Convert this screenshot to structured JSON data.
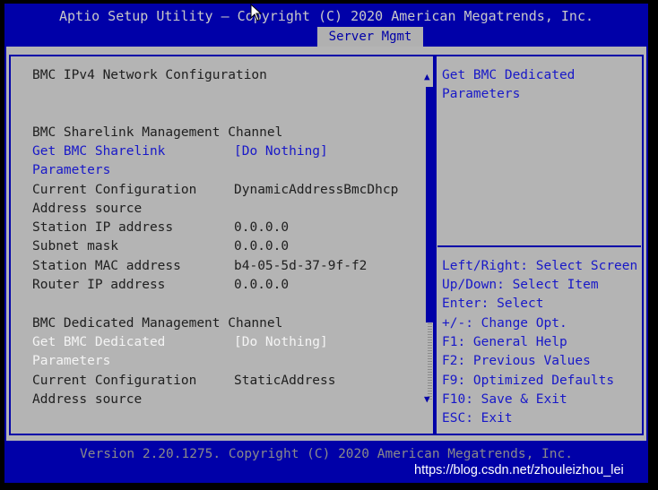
{
  "header": {
    "title": "Aptio Setup Utility – Copyright (C) 2020 American Megatrends, Inc.",
    "active_tab": "Server Mgmt"
  },
  "main": {
    "section_title": "BMC IPv4 Network Configuration",
    "sharelink": {
      "heading": "BMC Sharelink Management Channel",
      "option_label_1": "Get BMC Sharelink",
      "option_label_2": "Parameters",
      "option_value": "[Do Nothing]",
      "rows": [
        {
          "label": "Current Configuration",
          "value": "DynamicAddressBmcDhcp"
        },
        {
          "label": "Address source",
          "value": ""
        },
        {
          "label": "Station IP address",
          "value": "0.0.0.0"
        },
        {
          "label": "Subnet mask",
          "value": "0.0.0.0"
        },
        {
          "label": "Station MAC address",
          "value": "b4-05-5d-37-9f-f2"
        },
        {
          "label": "Router IP address",
          "value": "0.0.0.0"
        }
      ]
    },
    "dedicated": {
      "heading": "BMC Dedicated Management Channel",
      "option_label_1": "Get BMC Dedicated",
      "option_label_2": "Parameters",
      "option_value": "[Do Nothing]",
      "rows": [
        {
          "label": "Current Configuration",
          "value": "StaticAddress"
        },
        {
          "label": "Address source",
          "value": ""
        }
      ]
    }
  },
  "help": {
    "description_1": "Get BMC Dedicated",
    "description_2": "Parameters",
    "keys": [
      "Left/Right: Select Screen",
      "Up/Down: Select Item",
      "Enter: Select",
      "+/-: Change Opt.",
      "F1: General Help",
      "F2: Previous Values",
      "F9: Optimized Defaults",
      "F10: Save & Exit",
      "ESC: Exit"
    ]
  },
  "footer": {
    "version": "Version 2.20.1275. Copyright (C) 2020 American Megatrends, Inc.",
    "watermark": "https://blog.csdn.net/zhouleizhou_lei"
  },
  "colors": {
    "bios_blue": "#0000a8",
    "panel_gray": "#b4b4b4",
    "highlight_white": "#f4f4f4",
    "option_blue": "#1818c8"
  }
}
